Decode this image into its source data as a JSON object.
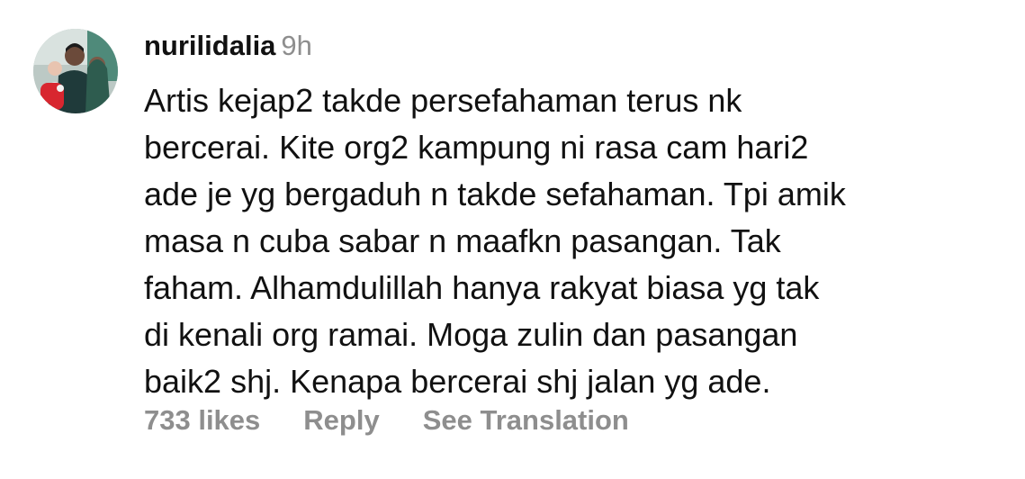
{
  "comment": {
    "username": "nurilidalia",
    "timestamp": "9h",
    "text_lines": [
      "Artis kejap2 takde persefahaman terus nk",
      "bercerai. Kite org2 kampung ni rasa cam hari2",
      "ade je yg bergaduh n takde sefahaman. Tpi amik",
      "masa n cuba sabar n maafkn pasangan. Tak",
      "faham. Alhamdulillah  hanya rakyat biasa yg tak",
      "di kenali org ramai. Moga zulin dan pasangan",
      "baik2 shj. Kenapa bercerai shj jalan yg ade."
    ],
    "likes_label": "733 likes",
    "reply_label": "Reply",
    "translation_label": "See Translation"
  },
  "colors": {
    "text": "#111111",
    "muted": "#8e8e8e",
    "background": "#ffffff"
  }
}
